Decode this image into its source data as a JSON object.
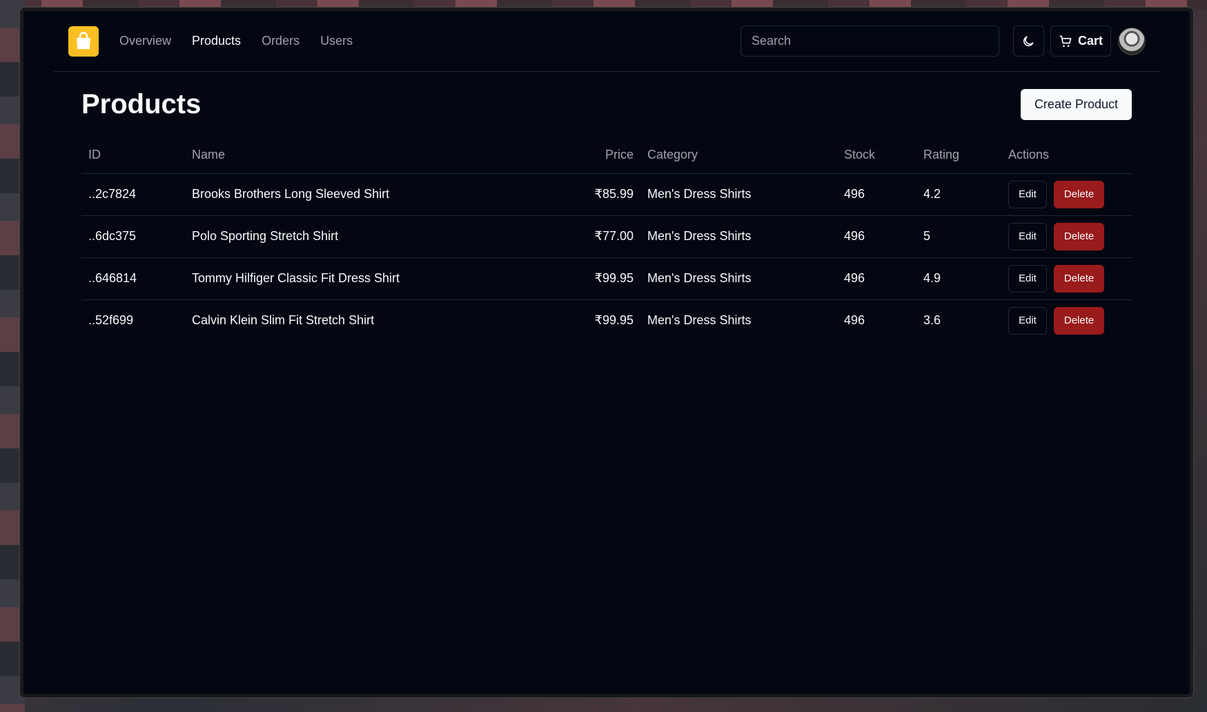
{
  "nav": {
    "links": [
      "Overview",
      "Products",
      "Orders",
      "Users"
    ],
    "active": "Products",
    "search_placeholder": "Search",
    "cart_label": "Cart"
  },
  "page": {
    "title": "Products",
    "create_label": "Create Product"
  },
  "table": {
    "headers": [
      "ID",
      "Name",
      "Price",
      "Category",
      "Stock",
      "Rating",
      "Actions"
    ],
    "rows": [
      {
        "id": "..2c7824",
        "name": "Brooks Brothers Long Sleeved Shirt",
        "price": "₹85.99",
        "category": "Men's Dress Shirts",
        "stock": "496",
        "rating": "4.2"
      },
      {
        "id": "..6dc375",
        "name": "Polo Sporting Stretch Shirt",
        "price": "₹77.00",
        "category": "Men's Dress Shirts",
        "stock": "496",
        "rating": "5"
      },
      {
        "id": "..646814",
        "name": "Tommy Hilfiger Classic Fit Dress Shirt",
        "price": "₹99.95",
        "category": "Men's Dress Shirts",
        "stock": "496",
        "rating": "4.9"
      },
      {
        "id": "..52f699",
        "name": "Calvin Klein Slim Fit Stretch Shirt",
        "price": "₹99.95",
        "category": "Men's Dress Shirts",
        "stock": "496",
        "rating": "3.6"
      }
    ],
    "edit_label": "Edit",
    "delete_label": "Delete"
  },
  "colors": {
    "background": "#030712",
    "logo": "#fbbf24",
    "delete": "#991b1b",
    "border": "#1f2937",
    "muted": "#9ca3af"
  },
  "icons": {
    "logo": "shopping-bag-icon",
    "theme": "moon-icon",
    "cart": "cart-icon"
  }
}
